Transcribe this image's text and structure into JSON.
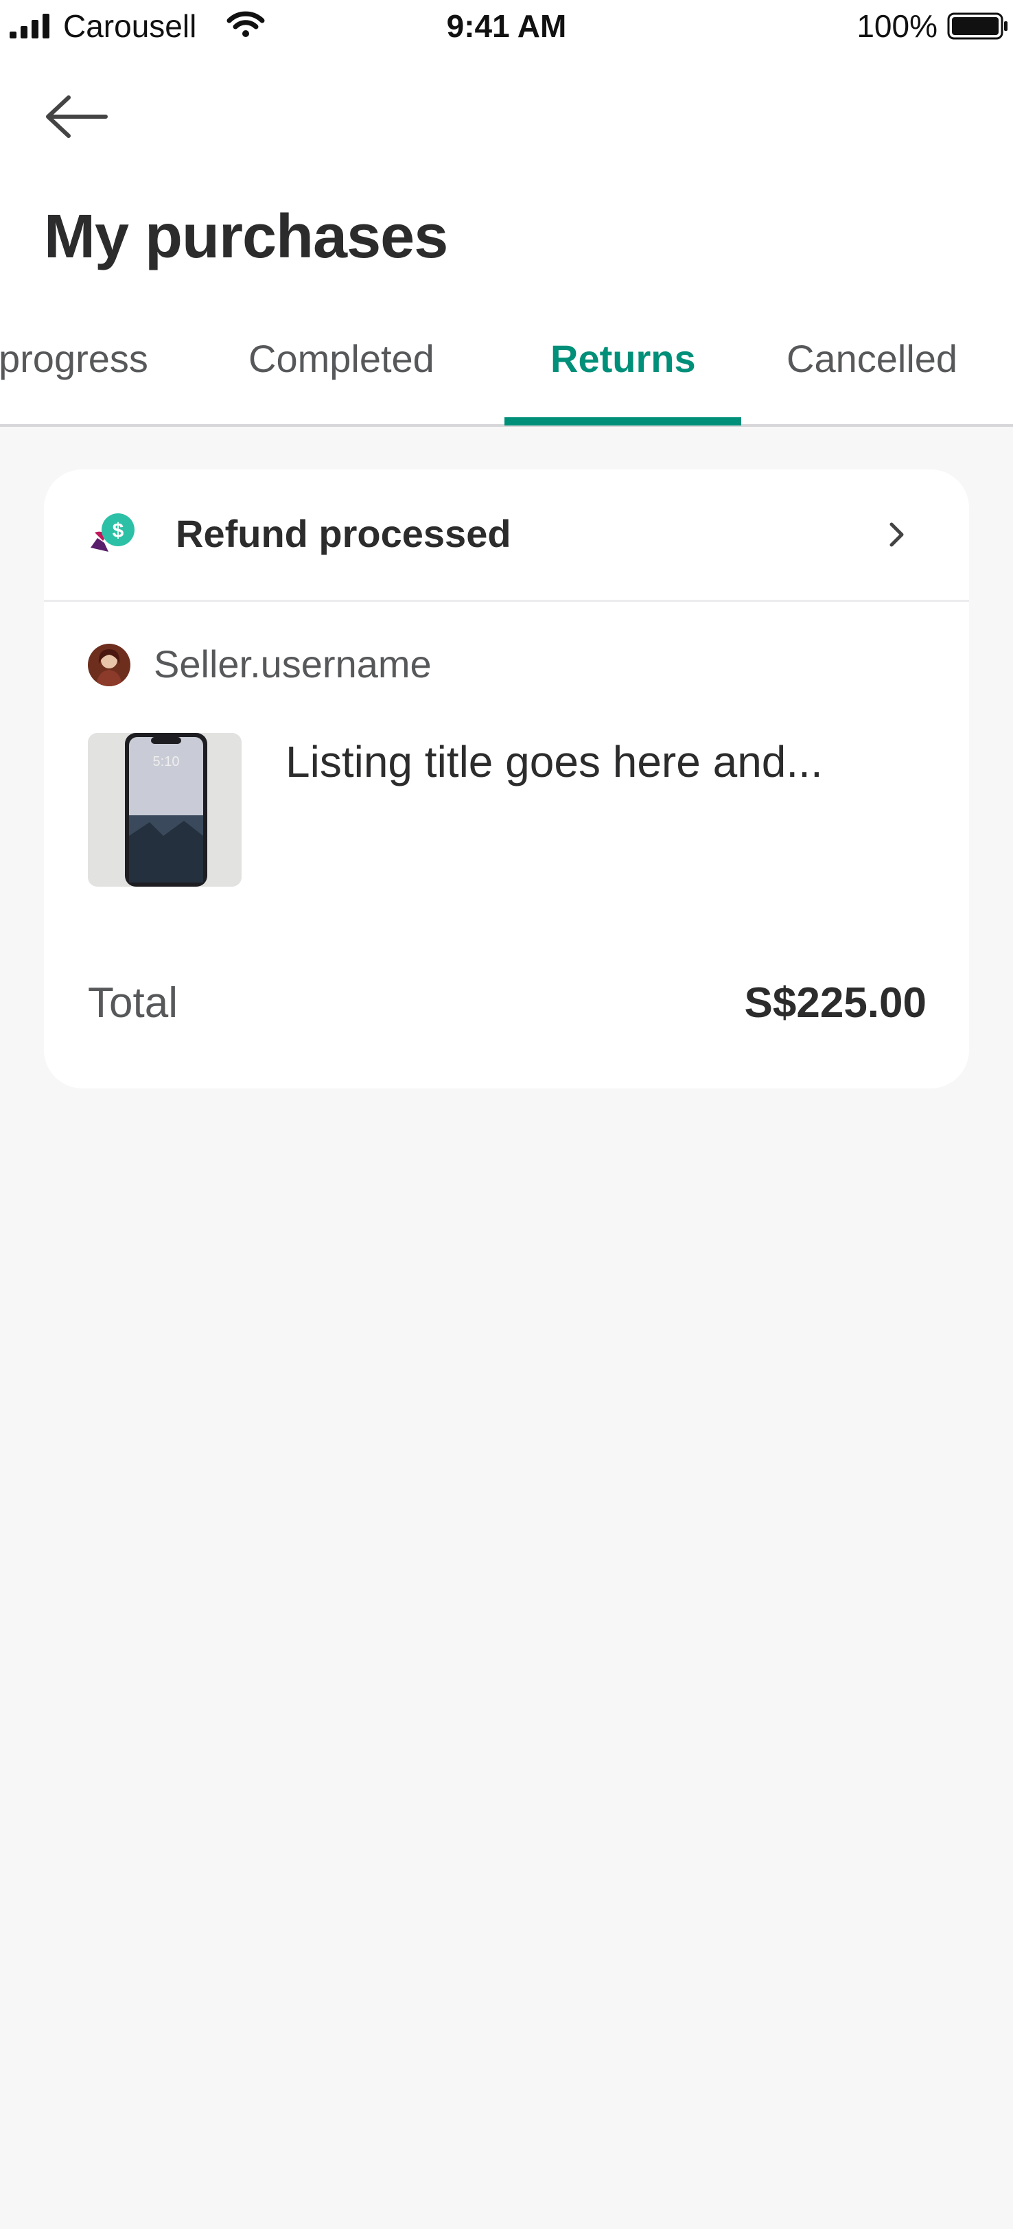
{
  "status_bar": {
    "carrier": "Carousell",
    "time": "9:41 AM",
    "battery": "100%"
  },
  "header": {
    "title": "My purchases"
  },
  "tabs": [
    {
      "label": "In progress",
      "visible_label": "progress",
      "active": false
    },
    {
      "label": "Completed",
      "active": false
    },
    {
      "label": "Returns",
      "active": true
    },
    {
      "label": "Cancelled",
      "active": false
    }
  ],
  "order": {
    "status": "Refund processed",
    "seller": "Seller.username",
    "listing_title": "Listing title goes here and...",
    "total_label": "Total",
    "total_value": "S$225.00"
  },
  "colors": {
    "accent": "#008f79",
    "refund_icon_green": "#2cc0a6",
    "refund_icon_purple": "#5a1f6b"
  },
  "icons": {
    "back": "arrow-left-icon",
    "status": "refund-icon",
    "chevron": "chevron-right-icon"
  }
}
